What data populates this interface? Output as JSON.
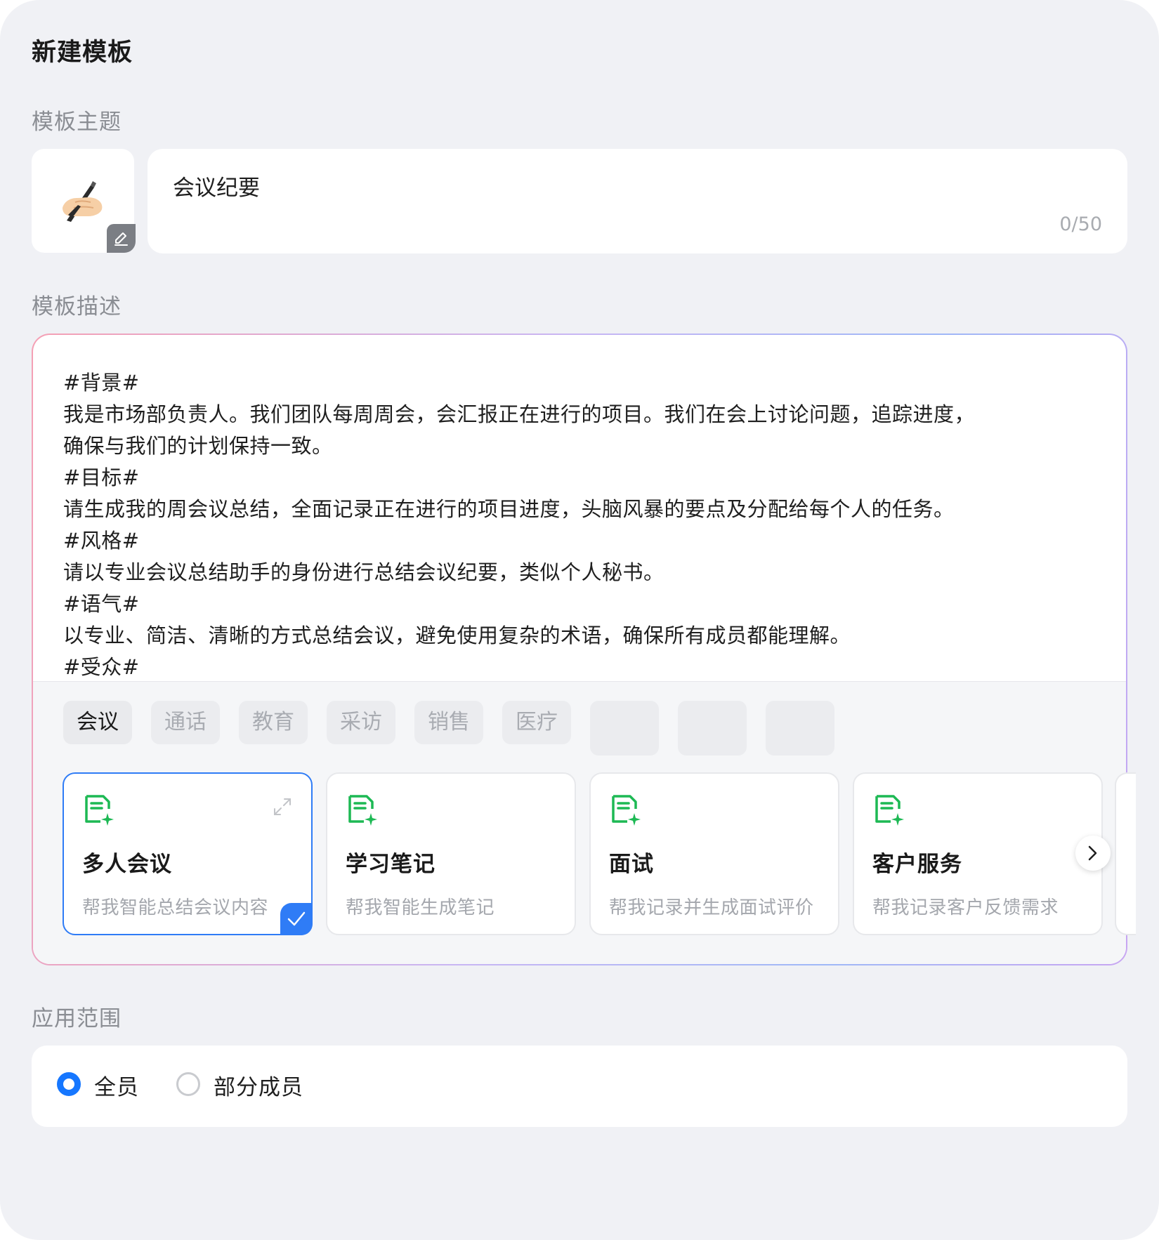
{
  "page": {
    "title": "新建模板"
  },
  "theme": {
    "label": "模板主题",
    "emoji_icon": "writing-hand-emoji",
    "edit_icon": "pencil-icon",
    "value": "会议纪要",
    "counter": "0/50"
  },
  "description": {
    "label": "模板描述",
    "lines": [
      "#背景#",
      "我是市场部负责人。我们团队每周周会，会汇报正在进行的项目。我们在会上讨论问题，追踪进度，",
      "确保与我们的计划保持一致。",
      "#目标#",
      "请生成我的周会议总结，全面记录正在进行的项目进度，头脑风暴的要点及分配给每个人的任务。",
      "#风格#",
      "请以专业会议总结助手的身份进行总结会议纪要，类似个人秘书。",
      "#语气#",
      "以专业、简洁、清晰的方式总结会议，避免使用复杂的术语，确保所有成员都能理解。",
      "#受众#"
    ]
  },
  "categories": [
    "会议",
    "通话",
    "教育",
    "采访",
    "销售",
    "医疗"
  ],
  "active_category": "会议",
  "cards": [
    {
      "title": "多人会议",
      "desc": "帮我智能总结会议内容",
      "selected": true
    },
    {
      "title": "学习笔记",
      "desc": "帮我智能生成笔记",
      "selected": false
    },
    {
      "title": "面试",
      "desc": "帮我记录并生成面试评价",
      "selected": false
    },
    {
      "title": "客户服务",
      "desc": "帮我记录客户反馈需求",
      "selected": false
    }
  ],
  "scope": {
    "label": "应用范围",
    "options": [
      {
        "label": "全员",
        "selected": true
      },
      {
        "label": "部分成员",
        "selected": false
      }
    ]
  },
  "colors": {
    "accent": "#1677ff",
    "card_selected_border": "#2f7cf6",
    "doc_icon_green": "#1db954",
    "panel_bg": "#f0f1f5"
  }
}
